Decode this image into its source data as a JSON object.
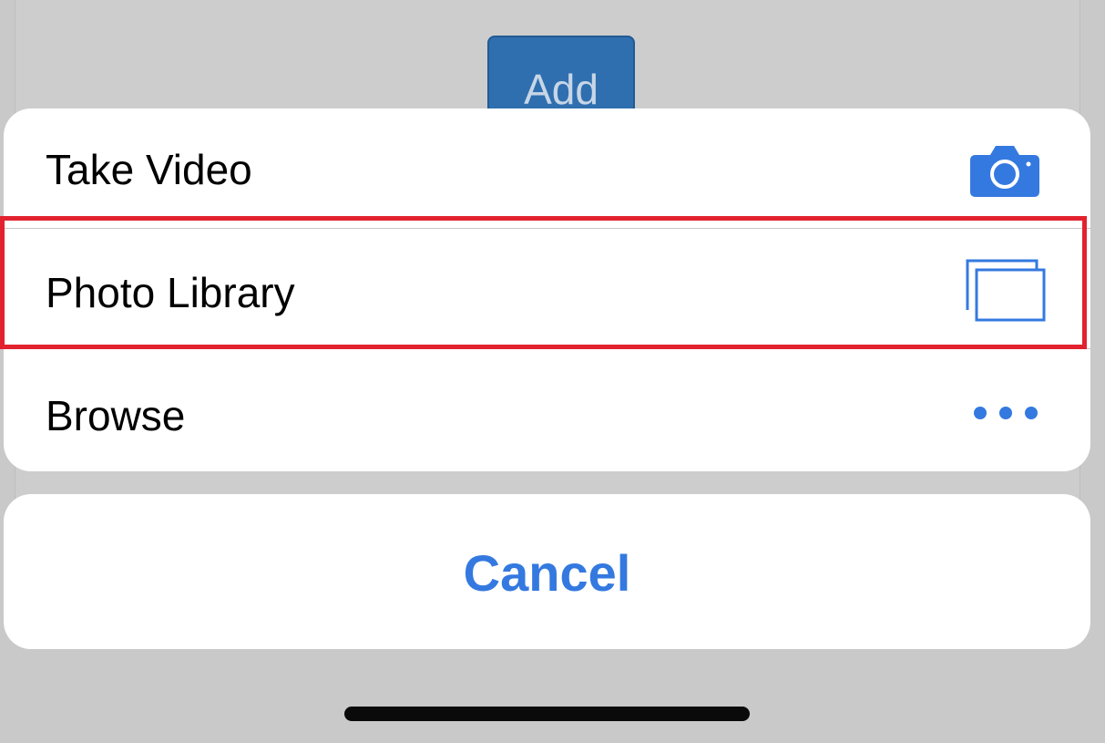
{
  "background": {
    "add_button_label": "Add"
  },
  "action_sheet": {
    "items": [
      {
        "label": "Take Video",
        "icon": "camera-icon"
      },
      {
        "label": "Photo Library",
        "icon": "photo-library-icon",
        "highlighted": true
      },
      {
        "label": "Browse",
        "icon": "more-dots-icon"
      }
    ],
    "cancel_label": "Cancel"
  },
  "colors": {
    "accent": "#3479e0",
    "highlight": "#e2222f",
    "sheet_background": "#ffffff",
    "dimmed_background": "#c9c9c9"
  }
}
